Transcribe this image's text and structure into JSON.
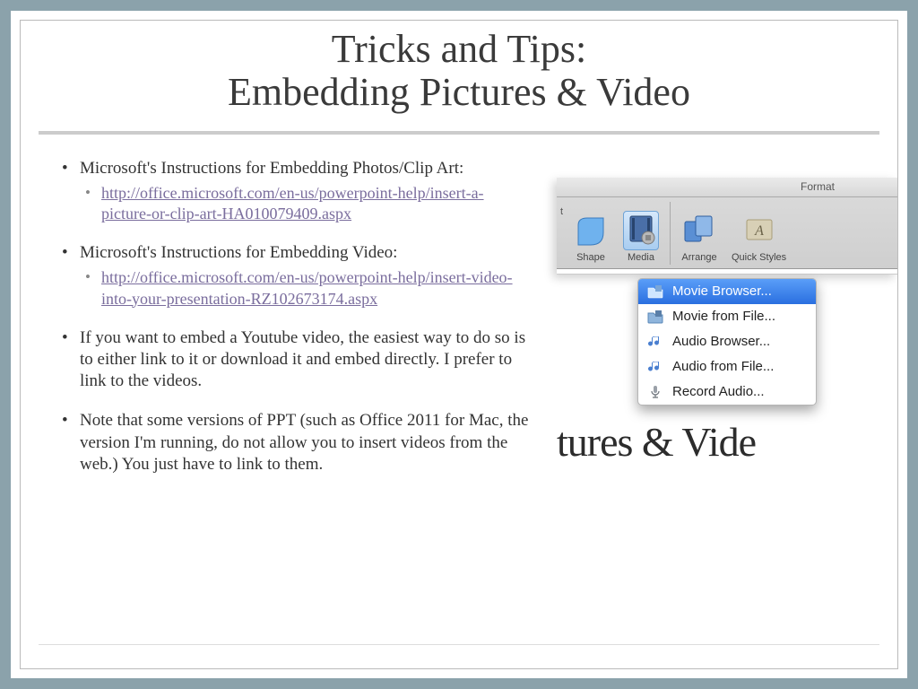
{
  "title": {
    "line1": "Tricks and Tips:",
    "line2": "Embedding Pictures & Video"
  },
  "bullets": [
    {
      "text": "Microsoft's Instructions for Embedding Photos/Clip Art:",
      "link": "http://office.microsoft.com/en-us/powerpoint-help/insert-a-picture-or-clip-art-HA010079409.aspx"
    },
    {
      "text": "Microsoft's Instructions for Embedding Video:",
      "link": "http://office.microsoft.com/en-us/powerpoint-help/insert-video-into-your-presentation-RZ102673174.aspx"
    },
    {
      "text": "If you want to embed a Youtube video, the easiest way to do so is to either link to it or download it and embed directly.  I prefer to link to the videos."
    },
    {
      "text": "Note that some versions of PPT (such as Office 2011 for Mac, the version I'm running, do not allow you to insert videos from the web.)  You just have to link to them."
    }
  ],
  "ribbon": {
    "tab_partial": "t",
    "format_label": "Format",
    "buttons": {
      "shape": "Shape",
      "media": "Media",
      "arrange": "Arrange",
      "quick": "Quick Styles"
    }
  },
  "dropdown": {
    "items": [
      {
        "label": "Movie Browser...",
        "icon": "folder-film-icon",
        "selected": true
      },
      {
        "label": "Movie from File...",
        "icon": "folder-film-icon",
        "selected": false
      },
      {
        "label": "Audio Browser...",
        "icon": "music-note-icon",
        "selected": false
      },
      {
        "label": "Audio from File...",
        "icon": "music-note-icon",
        "selected": false
      },
      {
        "label": "Record Audio...",
        "icon": "microphone-icon",
        "selected": false
      }
    ]
  },
  "behind_text": "tures & Vide"
}
